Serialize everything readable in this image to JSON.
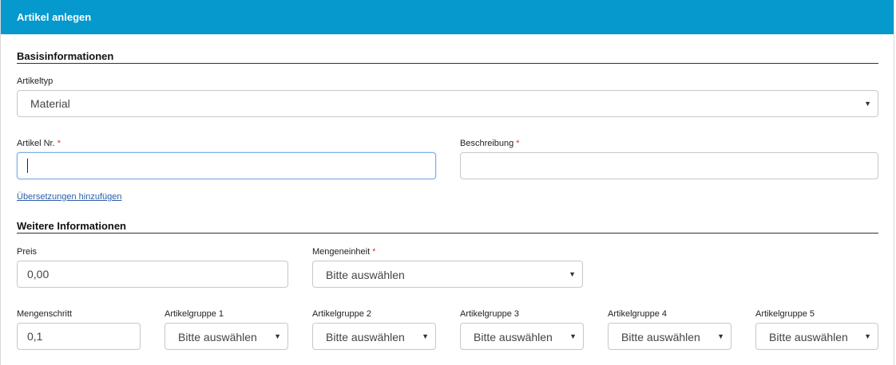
{
  "header": {
    "title": "Artikel anlegen"
  },
  "basis": {
    "title": "Basisinformationen",
    "artikeltyp": {
      "label": "Artikeltyp",
      "value": "Material"
    },
    "artikelnr": {
      "label": "Artikel Nr.",
      "required_mark": "*",
      "value": ""
    },
    "beschreibung": {
      "label": "Beschreibung",
      "required_mark": "*",
      "value": ""
    },
    "translations_link": "Übersetzungen hinzufügen"
  },
  "weitere": {
    "title": "Weitere Informationen",
    "preis": {
      "label": "Preis",
      "value": "0,00"
    },
    "mengeneinheit": {
      "label": "Mengeneinheit",
      "required_mark": "*",
      "value": "Bitte auswählen"
    },
    "mengenschritt": {
      "label": "Mengenschritt",
      "value": "0,1"
    },
    "artikelgruppe1": {
      "label": "Artikelgruppe 1",
      "value": "Bitte auswählen"
    },
    "artikelgruppe2": {
      "label": "Artikelgruppe 2",
      "value": "Bitte auswählen"
    },
    "artikelgruppe3": {
      "label": "Artikelgruppe 3",
      "value": "Bitte auswählen"
    },
    "artikelgruppe4": {
      "label": "Artikelgruppe 4",
      "value": "Bitte auswählen"
    },
    "artikelgruppe5": {
      "label": "Artikelgruppe 5",
      "value": "Bitte auswählen"
    }
  },
  "icons": {
    "dropdown": "caret-down-icon"
  },
  "colors": {
    "header_bg": "#0599cd",
    "required": "#e0352b",
    "link": "#2a5fa8",
    "focus_border": "#7aaee0"
  }
}
